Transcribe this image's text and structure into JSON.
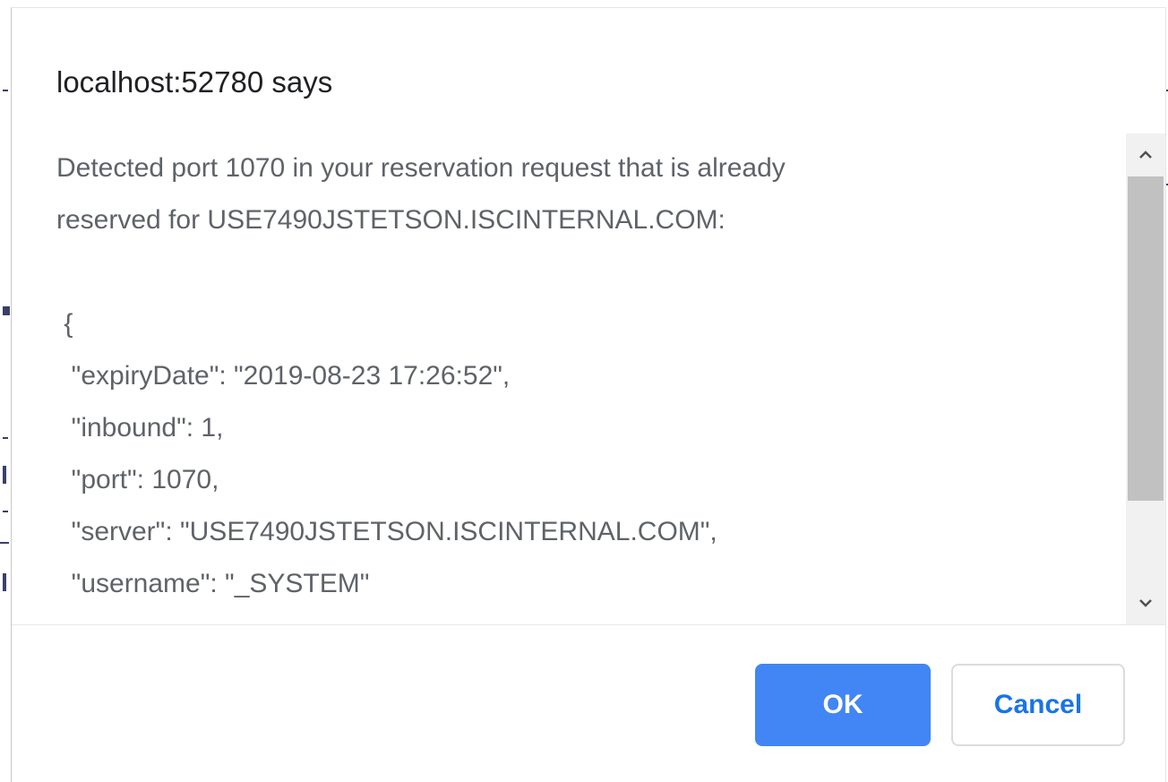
{
  "dialog": {
    "title": "localhost:52780 says",
    "message": "Detected port 1070 in your reservation request that is already\nreserved for USE7490JSTETSON.ISCINTERNAL.COM:\n\n {\n  \"expiryDate\": \"2019-08-23 17:26:52\",\n  \"inbound\": 1,\n  \"port\": 1070,\n  \"server\": \"USE7490JSTETSON.ISCINTERNAL.COM\",\n  \"username\": \"_SYSTEM\"\n }",
    "ok_label": "OK",
    "cancel_label": "Cancel"
  },
  "scrollbar": {
    "up_icon": "chevron-up-icon",
    "down_icon": "chevron-down-icon"
  },
  "colors": {
    "ok_background": "#4285f4",
    "cancel_text": "#1a73e8",
    "title_text": "#202124",
    "message_text": "#5f6368"
  }
}
